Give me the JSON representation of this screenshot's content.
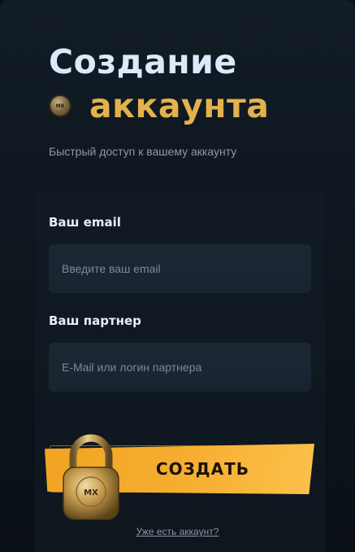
{
  "header": {
    "title_line1": "Создание",
    "title_line2": "аккаунта",
    "coin_logo_text": "MX",
    "subtitle": "Быстрый доступ к вашему аккаунту"
  },
  "form": {
    "email": {
      "label": "Ваш email",
      "placeholder": "Введите ваш email",
      "value": ""
    },
    "partner": {
      "label": "Ваш партнер",
      "placeholder": "E-Mail или логин партнера",
      "value": ""
    },
    "submit_label": "СОЗДАТЬ",
    "lock_logo_text": "MX",
    "login_link": "Уже есть аккаунт?"
  },
  "colors": {
    "background": "#0d151d",
    "title": "#dbe9f9",
    "accent": "#e3b24c",
    "button": "#f6ad2f",
    "input_bg": "#1b2833"
  }
}
